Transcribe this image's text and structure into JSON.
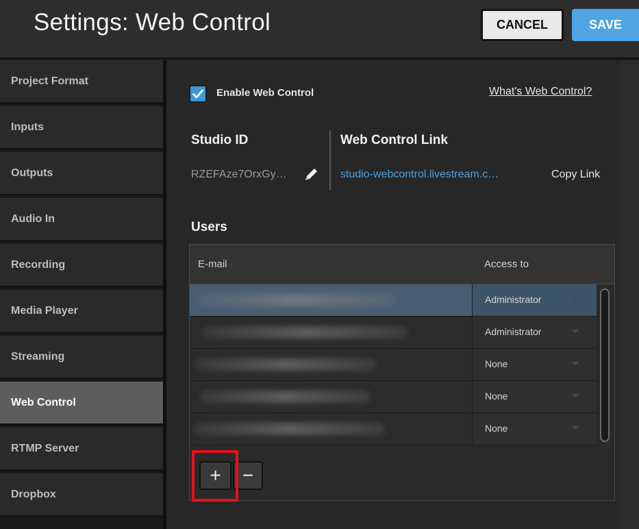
{
  "header": {
    "title": "Settings: Web Control",
    "cancel_label": "CANCEL",
    "save_label": "SAVE"
  },
  "sidebar": {
    "items": [
      {
        "label": "Project Format",
        "active": false
      },
      {
        "label": "Inputs",
        "active": false
      },
      {
        "label": "Outputs",
        "active": false
      },
      {
        "label": "Audio In",
        "active": false
      },
      {
        "label": "Recording",
        "active": false
      },
      {
        "label": "Media Player",
        "active": false
      },
      {
        "label": "Streaming",
        "active": false
      },
      {
        "label": "Web Control",
        "active": true
      },
      {
        "label": "RTMP Server",
        "active": false
      },
      {
        "label": "Dropbox",
        "active": false
      }
    ]
  },
  "web_control": {
    "enable_checked": true,
    "enable_label": "Enable Web Control",
    "whats_link": "What's Web Control?",
    "studio_id_heading": "Studio ID",
    "studio_id_value": "RZEFAze7OrxGy…",
    "link_heading": "Web Control Link",
    "link_value": "studio-webcontrol.livestream.c…",
    "copy_link": "Copy Link"
  },
  "users": {
    "heading": "Users",
    "columns": [
      "E-mail",
      "Access to"
    ],
    "rows": [
      {
        "access": "Administrator",
        "selected": true
      },
      {
        "access": "Administrator",
        "selected": false
      },
      {
        "access": "None",
        "selected": false
      },
      {
        "access": "None",
        "selected": false
      },
      {
        "access": "None",
        "selected": false
      }
    ],
    "add_label": "+",
    "remove_label": "−"
  },
  "colors": {
    "accent": "#4fa6e3",
    "link": "#4f9fdc",
    "highlight": "#e8101a",
    "active_sidebar": "#5d5d5d"
  }
}
